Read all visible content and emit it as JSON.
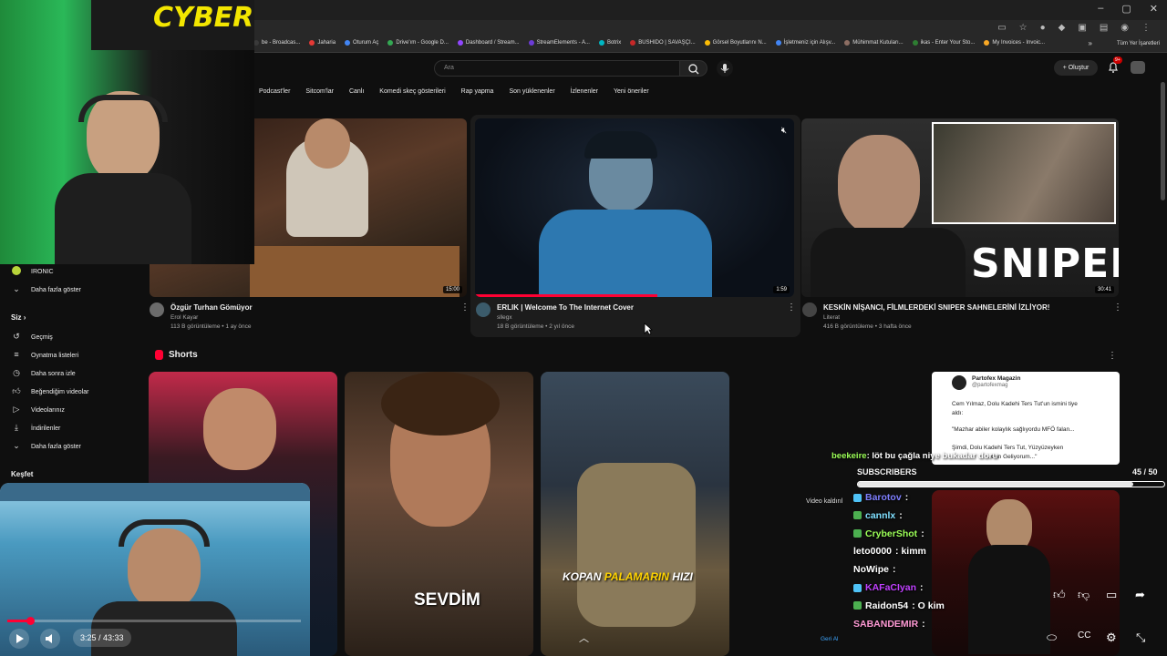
{
  "browser": {
    "window_controls": [
      "–",
      "▢",
      "✕"
    ],
    "bookmarks": [
      {
        "label": "be - Broadcas...",
        "color": "#3a3a3a"
      },
      {
        "label": "Jaharia",
        "color": "#e53935"
      },
      {
        "label": "Oturum Aç",
        "color": "#4285f4"
      },
      {
        "label": "Drive'ım - Google D...",
        "color": "#34a853"
      },
      {
        "label": "Dashboard / Stream...",
        "color": "#9146ff"
      },
      {
        "label": "StreamElements - A...",
        "color": "#6c3bd6"
      },
      {
        "label": "Botrix",
        "color": "#00b7c3"
      },
      {
        "label": "BUSHIDO | SAVAŞÇI...",
        "color": "#c62828"
      },
      {
        "label": "Görsel Boyutlarını N...",
        "color": "#fbbc05"
      },
      {
        "label": "İşletmeniz için Alışv...",
        "color": "#4285f4"
      },
      {
        "label": "Mühimmat Kutuları...",
        "color": "#8d6e63"
      },
      {
        "label": "ikas - Enter Your Sto...",
        "color": "#2e7d32"
      },
      {
        "label": "My Invoices - Invoic...",
        "color": "#f9a825"
      }
    ],
    "more_bookmarks": "»",
    "all_bookmarks": "Tüm Yer İşaretleri"
  },
  "header": {
    "search_placeholder": "Ara",
    "create_label": "Oluştur",
    "notification_count": "9+"
  },
  "chips": [
    "Podcast'ler",
    "Sitcom'lar",
    "Canlı",
    "Komedi skeç gösterileri",
    "Rap yapma",
    "Son yüklenenler",
    "İzlenenler",
    "Yeni öneriler"
  ],
  "sidebar": {
    "channel_ironic": "IRONIC",
    "show_more_1": "Daha fazla göster",
    "you_heading": "Siz",
    "you_chevron": "›",
    "items": [
      "Geçmiş",
      "Oynatma listeleri",
      "Daha sonra izle",
      "Beğendiğim videolar",
      "Videolarınız",
      "İndirilenler",
      "Daha fazla göster"
    ],
    "explore_heading": "Keşfet"
  },
  "videos": [
    {
      "title": "Özgür Turhan Gömüyor",
      "channel": "Erol Kayar",
      "meta": "113 B görüntüleme • 1 ay önce",
      "duration": "15:00"
    },
    {
      "title": "ERLIK | Welcome To The Internet Cover",
      "channel": "sllegx",
      "meta": "18 B görüntüleme • 2 yıl önce",
      "duration": "1:59"
    },
    {
      "title": "KESKİN NİŞANCI, FİLMLERDEKİ SNIPER SAHNELERİNİ İZLİYOR!",
      "channel": "Literat",
      "meta": "416 B görüntüleme • 3 hafta önce",
      "duration": "30:41",
      "thumb_text": "SNIPER"
    }
  ],
  "shorts": {
    "heading": "Shorts",
    "items": [
      {
        "caption": ""
      },
      {
        "caption": "SEVDİM"
      },
      {
        "caption_white": "KOPAN ",
        "caption_yellow": "PALAMARIN",
        "caption_white2": " HIZI"
      }
    ]
  },
  "tweet": {
    "account": "Partofex Magazin",
    "handle": "@partofexmag",
    "line1": "Cem Yılmaz, Dolu Kadehi Ters Tut'un ismini tiye",
    "line2": "aldı:",
    "line3": "\"Mazhar abiler kolaylık sağlıyordu MFÖ falan...",
    "line4": "Şimdi, Dolu Kadehi Ters Tut, Yüzyüzeyken",
    "line5": "...dan Geliyorum...\""
  },
  "stream_overlay": {
    "top_chat": {
      "user": "beekeire",
      "message": ": löt bu çağla niye bukadar doru"
    },
    "subs_label": "SUBSCRIBERS",
    "subs_count": "45",
    "subs_goal": "/ 50",
    "subs_progress": 0.9,
    "video_removed": "Video kaldırıl",
    "back_label": "Geri Al",
    "chat": [
      {
        "user": "Barotov",
        "message": ":",
        "color": "#7f7fff",
        "badge": "#4fc3f7"
      },
      {
        "user": "cannlx",
        "message": ":",
        "color": "#80e0ff",
        "badge": "#4caf50"
      },
      {
        "user": "CryberShot",
        "message": ":",
        "color": "#9cff57",
        "badge": "#4caf50"
      },
      {
        "user": "leto0000",
        "message": ": kimm",
        "color": "#ffffff",
        "badge": ""
      },
      {
        "user": "NoWipe",
        "message": ":",
        "color": "#ffffff",
        "badge": ""
      },
      {
        "user": "KAFaCIyan",
        "message": ":",
        "color": "#c040ff",
        "badge": "#4fc3f7"
      },
      {
        "user": "Raidon54",
        "message": ": O kim",
        "color": "#ffffff",
        "badge": "#4caf50"
      },
      {
        "user": "SABANDEMIR",
        "message": ":",
        "color": "#ff9ad5",
        "badge": ""
      }
    ]
  },
  "player": {
    "time": "3:25 / 43:33",
    "progress": 0.079
  }
}
